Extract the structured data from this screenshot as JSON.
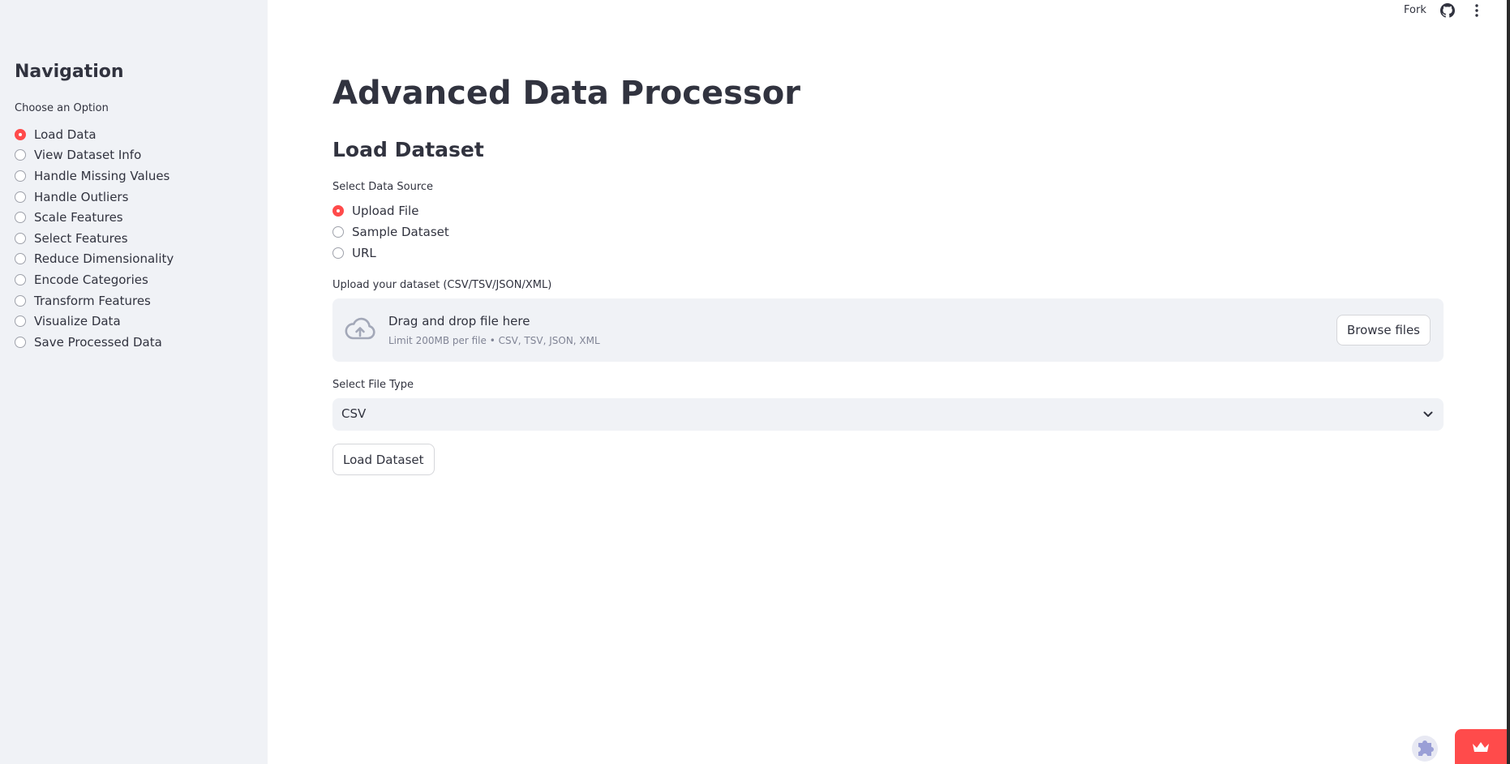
{
  "sidebar": {
    "title": "Navigation",
    "choose_label": "Choose an Option",
    "options": [
      {
        "label": "Load Data",
        "selected": true
      },
      {
        "label": "View Dataset Info",
        "selected": false
      },
      {
        "label": "Handle Missing Values",
        "selected": false
      },
      {
        "label": "Handle Outliers",
        "selected": false
      },
      {
        "label": "Scale Features",
        "selected": false
      },
      {
        "label": "Select Features",
        "selected": false
      },
      {
        "label": "Reduce Dimensionality",
        "selected": false
      },
      {
        "label": "Encode Categories",
        "selected": false
      },
      {
        "label": "Transform Features",
        "selected": false
      },
      {
        "label": "Visualize Data",
        "selected": false
      },
      {
        "label": "Save Processed Data",
        "selected": false
      }
    ]
  },
  "toolbar": {
    "fork_label": "Fork",
    "github_icon": "github-icon",
    "menu_icon": "kebab-menu-icon"
  },
  "main": {
    "title": "Advanced Data Processor",
    "section_title": "Load Dataset",
    "source_label": "Select Data Source",
    "sources": [
      {
        "label": "Upload File",
        "selected": true
      },
      {
        "label": "Sample Dataset",
        "selected": false
      },
      {
        "label": "URL",
        "selected": false
      }
    ],
    "upload_label": "Upload your dataset (CSV/TSV/JSON/XML)",
    "dropzone": {
      "title": "Drag and drop file here",
      "subtitle": "Limit 200MB per file • CSV, TSV, JSON, XML",
      "browse_label": "Browse files",
      "icon": "cloud-upload-icon"
    },
    "filetype_label": "Select File Type",
    "filetype_value": "CSV",
    "load_button": "Load Dataset"
  },
  "colors": {
    "accent": "#ff4b4b",
    "sidebar_bg": "#f0f2f6",
    "text": "#31333f"
  }
}
